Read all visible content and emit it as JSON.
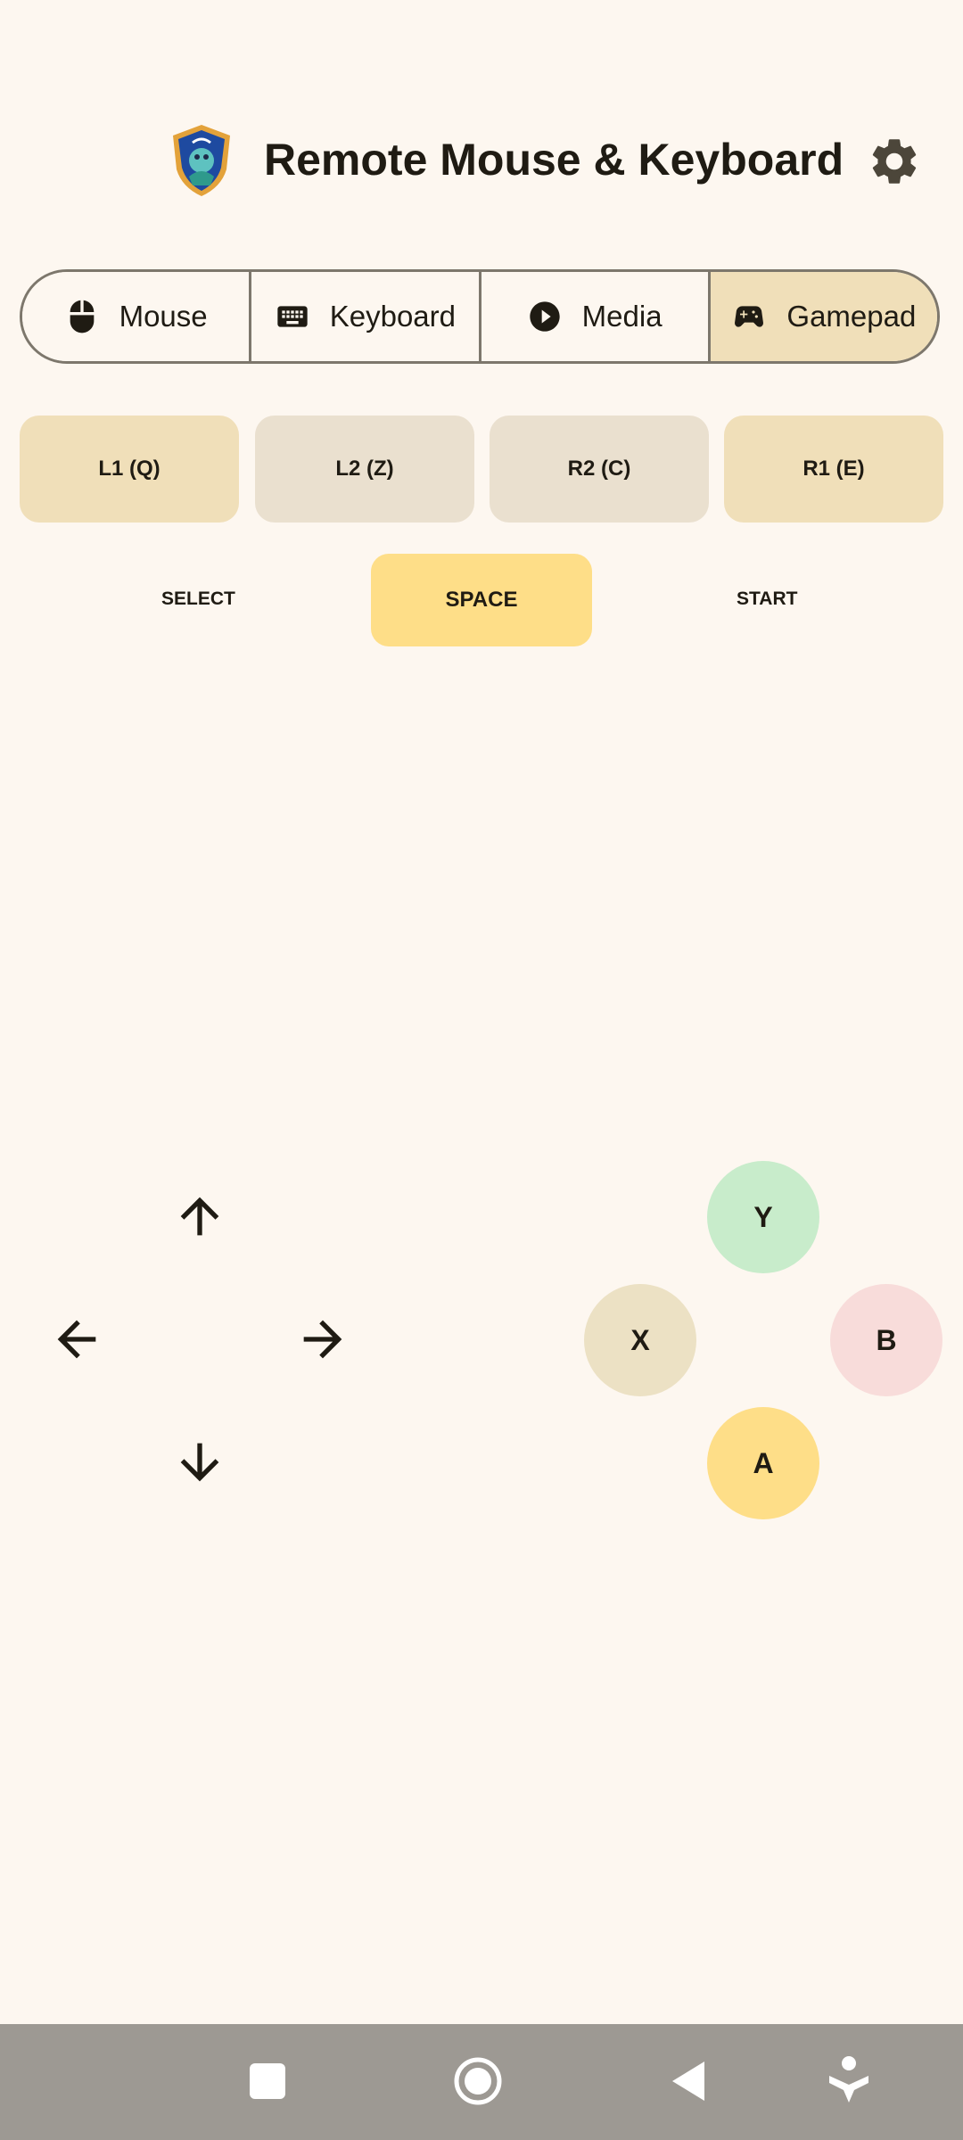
{
  "app": {
    "title": "Remote Mouse & Keyboard",
    "logo_icon": "shield-logo-icon",
    "settings_icon": "gear-icon"
  },
  "tabs": [
    {
      "label": "Mouse",
      "icon": "mouse-icon",
      "selected": false
    },
    {
      "label": "Keyboard",
      "icon": "keyboard-icon",
      "selected": false
    },
    {
      "label": "Media",
      "icon": "play-circle-icon",
      "selected": false
    },
    {
      "label": "Gamepad",
      "icon": "gamepad-icon",
      "selected": true
    }
  ],
  "shoulders": {
    "l1": "L1 (Q)",
    "l2": "L2 (Z)",
    "r2": "R2 (C)",
    "r1": "R1 (E)"
  },
  "center": {
    "select": "SELECT",
    "space": "SPACE",
    "start": "START"
  },
  "face": {
    "y": "Y",
    "x": "X",
    "b": "B",
    "a": "A"
  },
  "colors": {
    "background": "#fdf7f0",
    "selected_tab": "#f0dfb9",
    "space_button": "#fede88",
    "y_button": "#c8eccb",
    "x_button": "#ece1c4",
    "b_button": "#f8dcda",
    "a_button": "#fede88"
  },
  "navbar": [
    "square-icon",
    "circle-icon",
    "triangle-back-icon",
    "accessibility-icon"
  ]
}
